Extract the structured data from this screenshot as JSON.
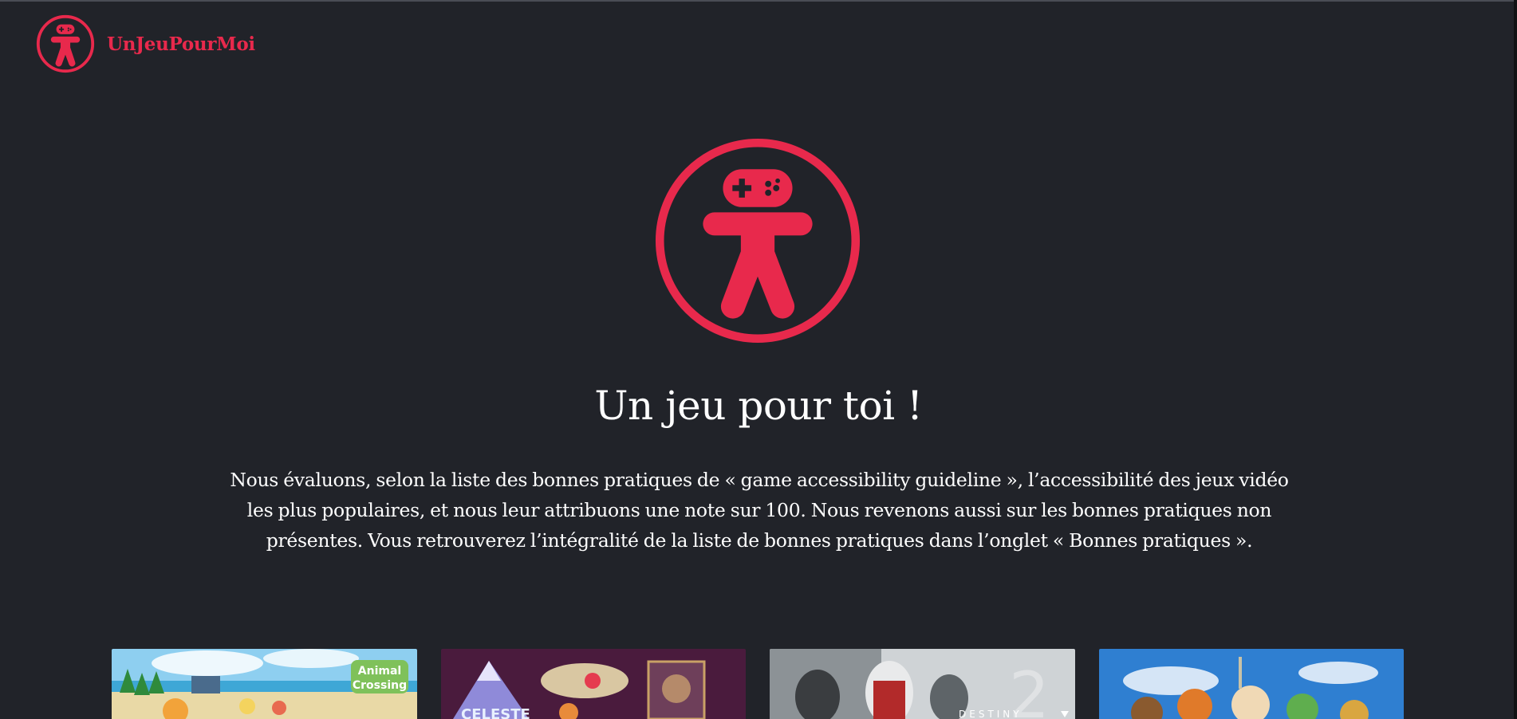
{
  "brand": {
    "name": "UnJeuPourMoi",
    "logo_icon": "gamer-person-icon"
  },
  "hero": {
    "logo_icon": "gamer-person-icon",
    "title": "Un jeu pour toi !",
    "intro": "Nous évaluons, selon la liste des bonnes pratiques de « game accessibility guideline », l’accessibilité des jeux vidéo les plus populaires, et nous leur attribuons une note sur 100. Nous revenons aussi sur les bonnes pratiques non présentes. Vous retrouverez l’intégralité de la liste de bonnes pratiques dans l’onglet « Bonnes pratiques »."
  },
  "cards": [
    {
      "image": "animal-crossing-cover",
      "cover_text": [
        "Animal",
        "Crossing"
      ]
    },
    {
      "image": "celeste-cover",
      "cover_text": [
        "CELESTE"
      ]
    },
    {
      "image": "destiny-2-cover",
      "cover_text": [
        "DESTINY"
      ]
    },
    {
      "image": "adventure-game-cover",
      "cover_text": []
    }
  ],
  "colors": {
    "accent": "#e8294c",
    "background": "#212329",
    "text": "#ffffff"
  }
}
